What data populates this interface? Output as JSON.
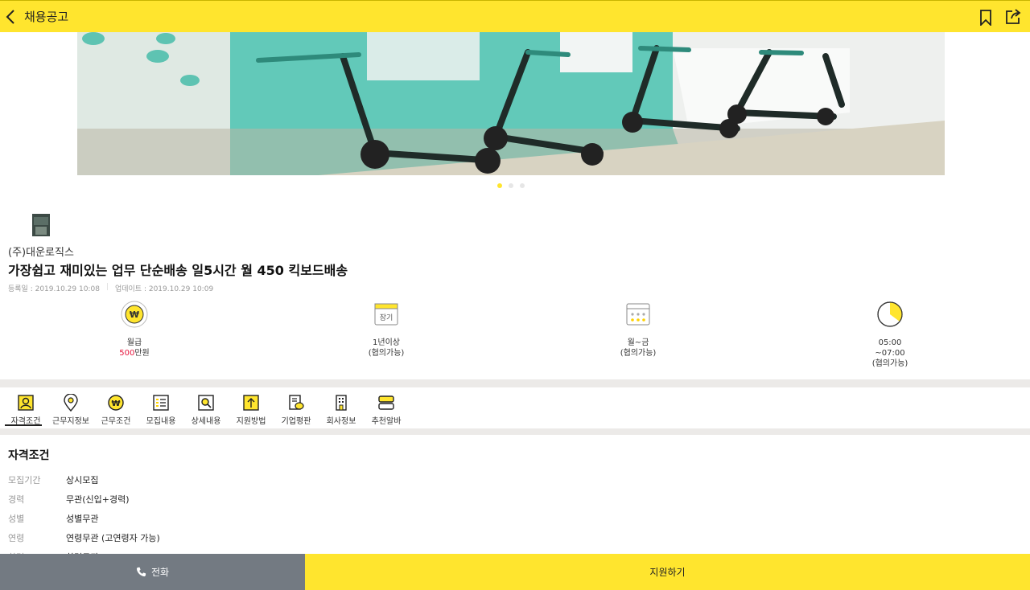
{
  "header": {
    "title": "채용공고"
  },
  "company": {
    "name": "(주)대운로직스"
  },
  "job": {
    "title": "가장쉽고 재미있는 업무 단순배송 일5시간 월 450 킥보드배송",
    "registered": "등록일 : 2019.10.29 10:08",
    "updated": "업데이트 : 2019.10.29 10:09"
  },
  "summary": {
    "pay": {
      "label": "월급",
      "amount": "500",
      "unit": "만원"
    },
    "period": {
      "icon_text": "장기",
      "line1": "1년이상",
      "line2": "(협의가능)"
    },
    "days": {
      "line1": "월~금",
      "line2": "(협의가능)"
    },
    "time": {
      "line1": "05:00",
      "line2": "~07:00",
      "line3": "(협의가능)"
    }
  },
  "tabs": [
    {
      "label": "자격조건",
      "icon": "person-search-icon"
    },
    {
      "label": "근무지정보",
      "icon": "map-pin-icon"
    },
    {
      "label": "근무조건",
      "icon": "won-coin-icon"
    },
    {
      "label": "모집내용",
      "icon": "checklist-icon"
    },
    {
      "label": "상세내용",
      "icon": "magnifier-icon"
    },
    {
      "label": "지원방법",
      "icon": "upload-icon"
    },
    {
      "label": "기업평판",
      "icon": "chat-doc-icon"
    },
    {
      "label": "회사정보",
      "icon": "building-icon"
    },
    {
      "label": "추천알바",
      "icon": "stack-icon"
    }
  ],
  "qualifications": {
    "title": "자격조건",
    "rows": [
      {
        "key": "모집기간",
        "value": "상시모집"
      },
      {
        "key": "경력",
        "value": "무관(신입+경력)"
      },
      {
        "key": "성별",
        "value": "성별무관"
      },
      {
        "key": "연령",
        "value": "연령무관 (고연령자 가능)"
      },
      {
        "key": "학력",
        "value": "학력무관"
      }
    ]
  },
  "bottom": {
    "call_label": "전화",
    "apply_label": "지원하기"
  },
  "colors": {
    "accent": "#ffe52e",
    "gray_button": "#737a82",
    "highlight": "#e6163d"
  }
}
